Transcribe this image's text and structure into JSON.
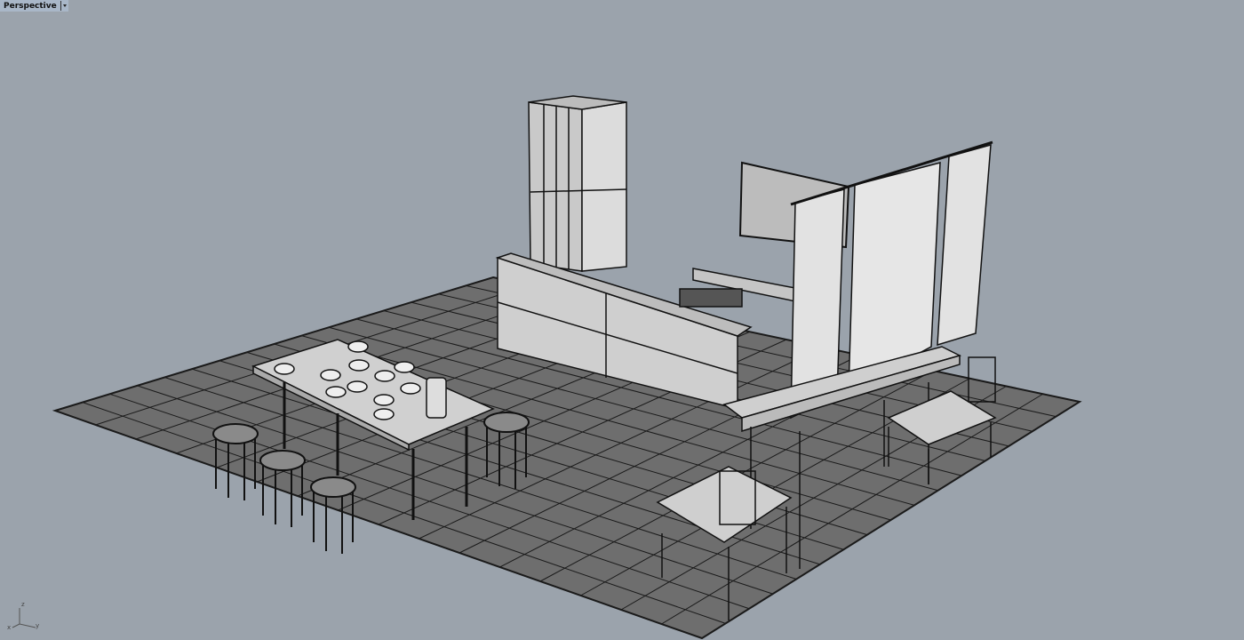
{
  "viewport": {
    "name": "Perspective",
    "menu_icon": "chevron-down-icon"
  },
  "axis_widget": {
    "x": "x",
    "y": "y",
    "z": "z"
  },
  "colors": {
    "background": "#9ba3ac",
    "floor_tile": "#6e6e6e",
    "grid_line": "#1a1a1a",
    "object_fill": "#d6d6d6",
    "object_edge": "#111111"
  }
}
